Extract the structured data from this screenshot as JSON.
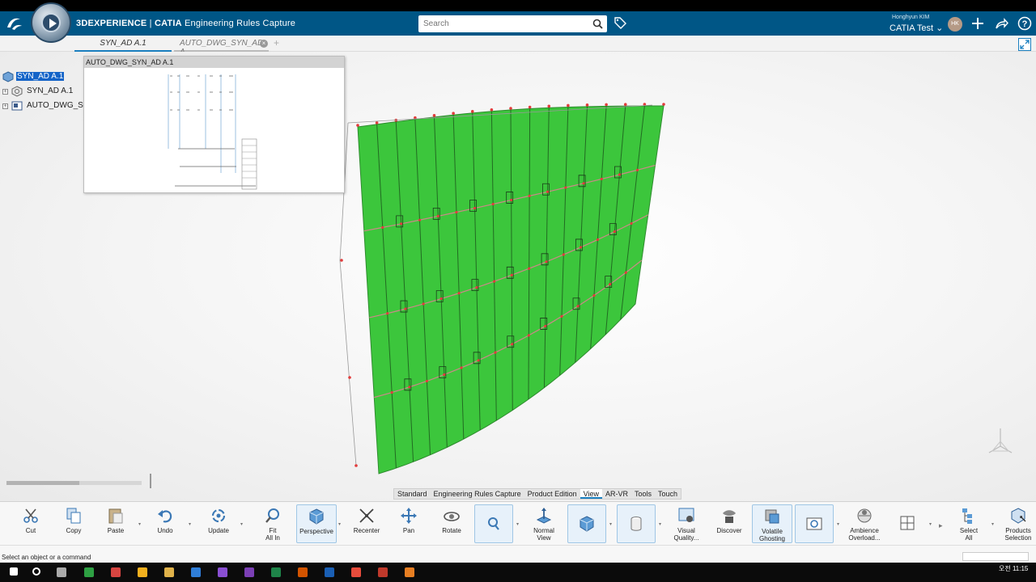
{
  "header": {
    "brand_bold": "3DEXPERIENCE",
    "brand_sep": " | ",
    "app_name_bold": "CATIA",
    "app_name_rest": " Engineering Rules Capture",
    "search_placeholder": "Search",
    "user_name": "Honghyun KIM",
    "collab_space": "CATIA Test",
    "avatar_initials": "HK"
  },
  "tabs": {
    "tab1_label": "SYN_AD A.1",
    "tab2_label": "AUTO_DWG_SYN_AD A",
    "add_symbol": "+"
  },
  "tree": {
    "root_label": "SYN_AD A.1",
    "child1_label": "SYN_AD A.1",
    "child2_label": "AUTO_DWG_SYN"
  },
  "preview": {
    "title": "AUTO_DWG_SYN_AD A.1"
  },
  "section_tabs": [
    "Standard",
    "Engineering Rules Capture",
    "Product Edition",
    "View",
    "AR-VR",
    "Tools",
    "Touch"
  ],
  "active_section_tab": "View",
  "commands": {
    "cut": "Cut",
    "copy": "Copy",
    "paste": "Paste",
    "undo": "Undo",
    "update": "Update",
    "fit_all_1": "Fit",
    "fit_all_2": "All In",
    "perspective": "Perspective",
    "recenter": "Recenter",
    "pan": "Pan",
    "rotate": "Rotate",
    "normal_view_1": "Normal",
    "normal_view_2": "View",
    "visual_quality_1": "Visual",
    "visual_quality_2": "Quality...",
    "discover": "Discover",
    "volatile_ghosting_1": "Volatile",
    "volatile_ghosting_2": "Ghosting",
    "ambience_1": "Ambience",
    "ambience_2": "Overload...",
    "select_all_1": "Select",
    "select_all_2": "All",
    "products_selection_1": "Products",
    "products_selection_2": "Selection"
  },
  "status": {
    "message": "Select an object or a command"
  },
  "taskbar": {
    "clock": "오전 11:15"
  },
  "colors": {
    "header_bg": "#005686",
    "surface_green": "#3cc63c",
    "accent_blue": "#1a7fbf"
  }
}
